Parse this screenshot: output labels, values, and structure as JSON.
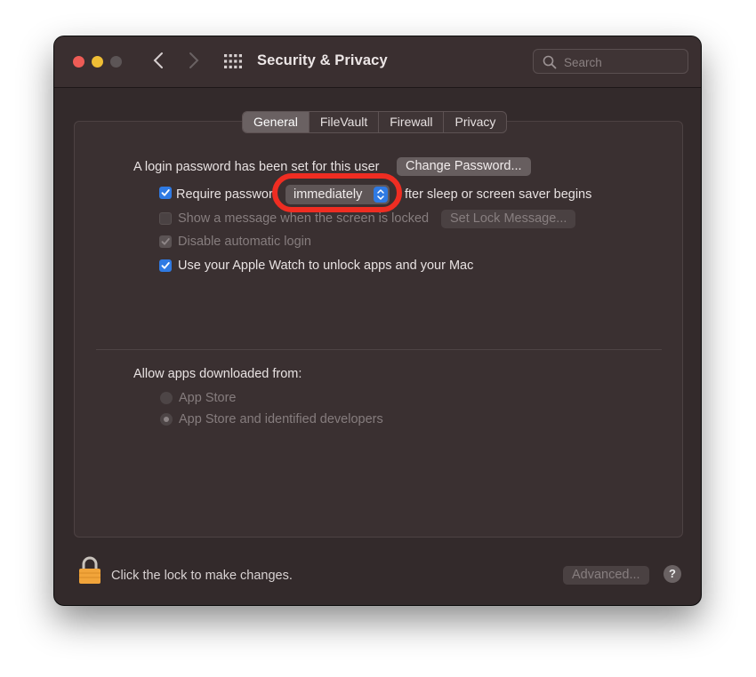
{
  "window": {
    "title": "Security & Privacy",
    "search": {
      "placeholder": "Search"
    }
  },
  "tabs": [
    {
      "label": "General",
      "active": true
    },
    {
      "label": "FileVault",
      "active": false
    },
    {
      "label": "Firewall",
      "active": false
    },
    {
      "label": "Privacy",
      "active": false
    }
  ],
  "general": {
    "login_text": "A login password has been set for this user",
    "change_password_label": "Change Password...",
    "require_password": {
      "checked": true,
      "label_before": "Require passwor",
      "popup_value": "immediately",
      "label_after": "fter sleep or screen saver begins"
    },
    "show_message": {
      "checked": false,
      "label": "Show a message when the screen is locked",
      "button_label": "Set Lock Message..."
    },
    "disable_auto_login": {
      "checked": true,
      "label": "Disable automatic login"
    },
    "apple_watch": {
      "checked": true,
      "label": "Use your Apple Watch to unlock apps and your Mac"
    }
  },
  "downloads": {
    "heading": "Allow apps downloaded from:",
    "options": [
      {
        "label": "App Store",
        "selected": false
      },
      {
        "label": "App Store and identified developers",
        "selected": true
      }
    ]
  },
  "footer": {
    "lock_text": "Click the lock to make changes.",
    "advanced_label": "Advanced...",
    "help_label": "?"
  },
  "colors": {
    "accent": "#2f7ae3",
    "highlight_ring": "#ef2d22",
    "window_bg": "#332a2b"
  }
}
